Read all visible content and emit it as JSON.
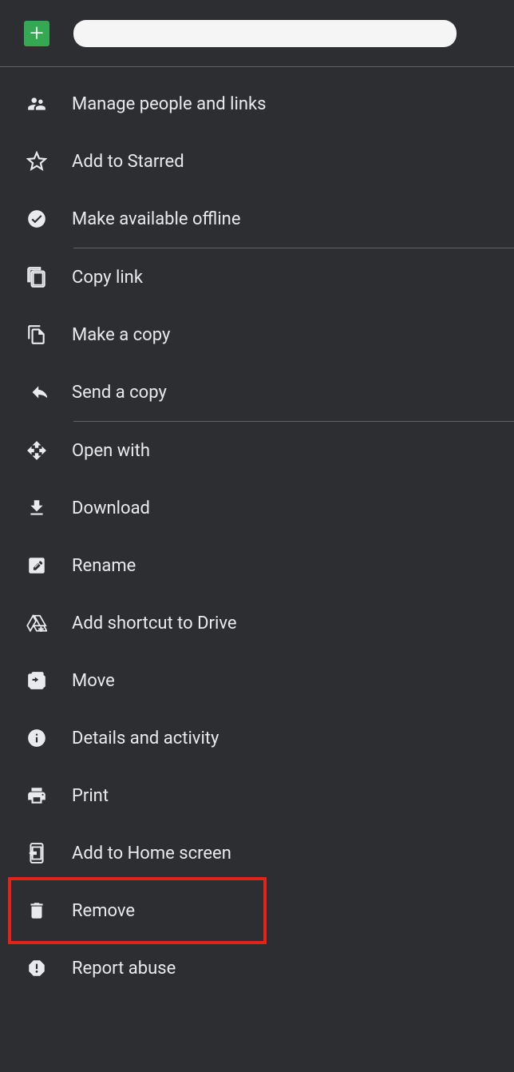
{
  "header": {
    "file_type": "sheets"
  },
  "menu": {
    "groups": [
      [
        {
          "id": "manage-people",
          "label": "Manage people and links",
          "icon": "people"
        },
        {
          "id": "add-starred",
          "label": "Add to Starred",
          "icon": "star"
        },
        {
          "id": "offline",
          "label": "Make available offline",
          "icon": "offline"
        }
      ],
      [
        {
          "id": "copy-link",
          "label": "Copy link",
          "icon": "copy-link"
        },
        {
          "id": "make-copy",
          "label": "Make a copy",
          "icon": "file-copy"
        },
        {
          "id": "send-copy",
          "label": "Send a copy",
          "icon": "send"
        }
      ],
      [
        {
          "id": "open-with",
          "label": "Open with",
          "icon": "open-with"
        },
        {
          "id": "download",
          "label": "Download",
          "icon": "download"
        },
        {
          "id": "rename",
          "label": "Rename",
          "icon": "rename"
        },
        {
          "id": "shortcut",
          "label": "Add shortcut to Drive",
          "icon": "drive-shortcut"
        },
        {
          "id": "move",
          "label": "Move",
          "icon": "folder-move"
        },
        {
          "id": "details",
          "label": "Details and activity",
          "icon": "info"
        },
        {
          "id": "print",
          "label": "Print",
          "icon": "print"
        },
        {
          "id": "home-screen",
          "label": "Add to Home screen",
          "icon": "add-home"
        },
        {
          "id": "remove",
          "label": "Remove",
          "icon": "trash",
          "highlighted": true
        },
        {
          "id": "report",
          "label": "Report abuse",
          "icon": "report"
        }
      ]
    ]
  }
}
